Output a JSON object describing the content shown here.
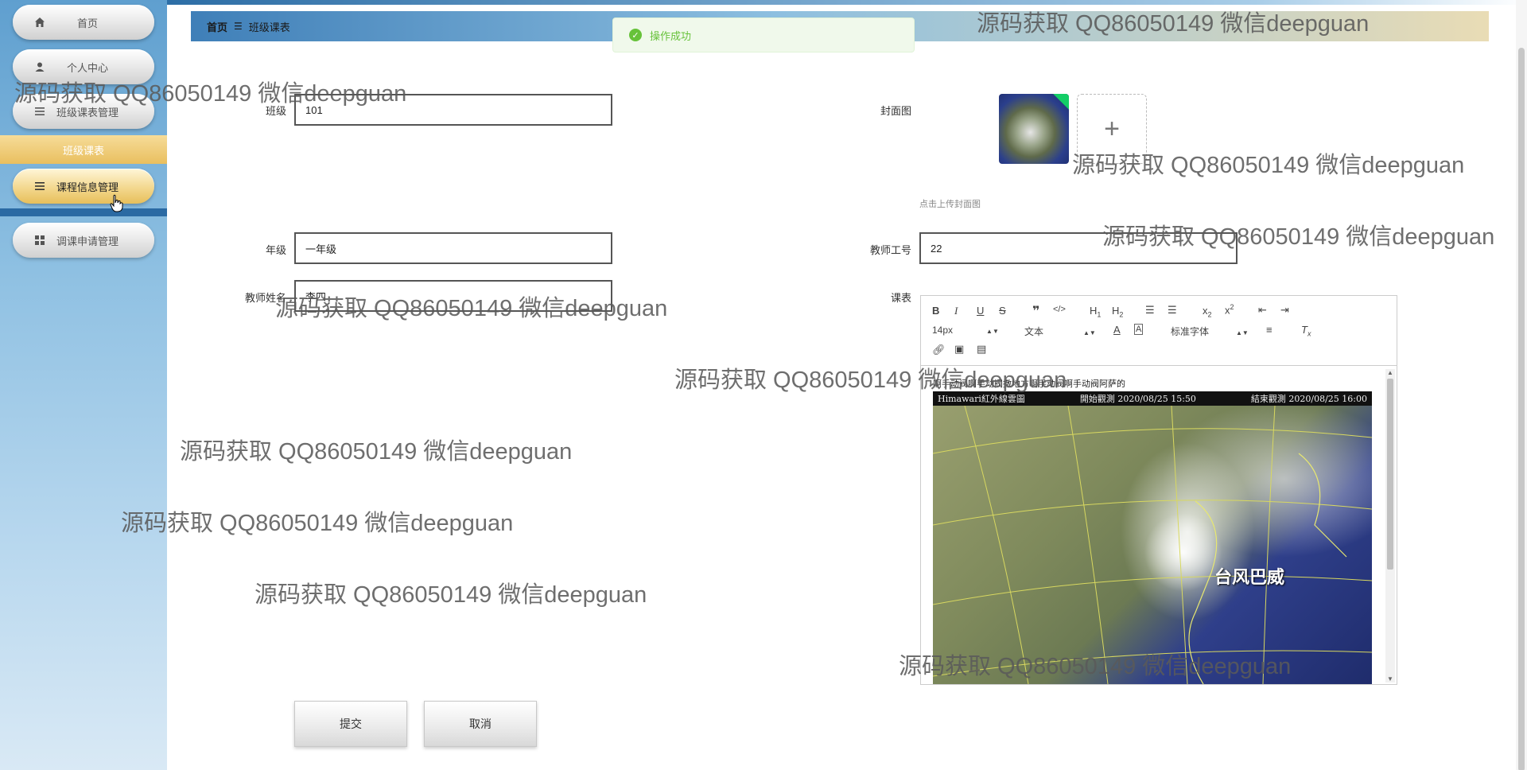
{
  "sidebar": {
    "items": [
      {
        "label": "首页",
        "icon": "home-icon"
      },
      {
        "label": "个人中心",
        "icon": "user-icon"
      },
      {
        "label": "班级课表管理",
        "icon": "list-icon"
      },
      {
        "label": "课程信息管理",
        "icon": "list-icon"
      },
      {
        "label": "调课申请管理",
        "icon": "grid-icon"
      }
    ],
    "group_label": "班级课表",
    "active_index": 3
  },
  "breadcrumb": {
    "home": "首页",
    "current": "班级课表"
  },
  "toast": {
    "text": "操作成功",
    "color": "#67c23a"
  },
  "form": {
    "class_label": "班级",
    "class_value": "101",
    "grade_label": "年级",
    "grade_value": "一年级",
    "teacher_name_label": "教师姓名",
    "teacher_name_value": "李四",
    "cover_label": "封面图",
    "cover_hint": "点击上传封面图",
    "teacher_id_label": "教师工号",
    "teacher_id_value": "22",
    "schedule_label": "课表"
  },
  "editor": {
    "font_size": "14px",
    "paragraph": "文本",
    "font_family": "标准字体",
    "content_text": "啊手动阀啊手动阀撒地方啊手动阀啊手动阀阿萨的",
    "image": {
      "header_left": "Himawari紅外線雲圖",
      "header_mid": "開始觀測 2020/08/25 15:50",
      "header_right": "結束觀測 2020/08/25 16:00",
      "label": "台风巴威"
    }
  },
  "buttons": {
    "submit": "提交",
    "cancel": "取消"
  },
  "watermark": "源码获取 QQ86050149 微信deepguan",
  "colors": {
    "accent_gold": "#e9bf5f",
    "sidebar_blue": "#5f9fcf",
    "success": "#67c23a"
  }
}
